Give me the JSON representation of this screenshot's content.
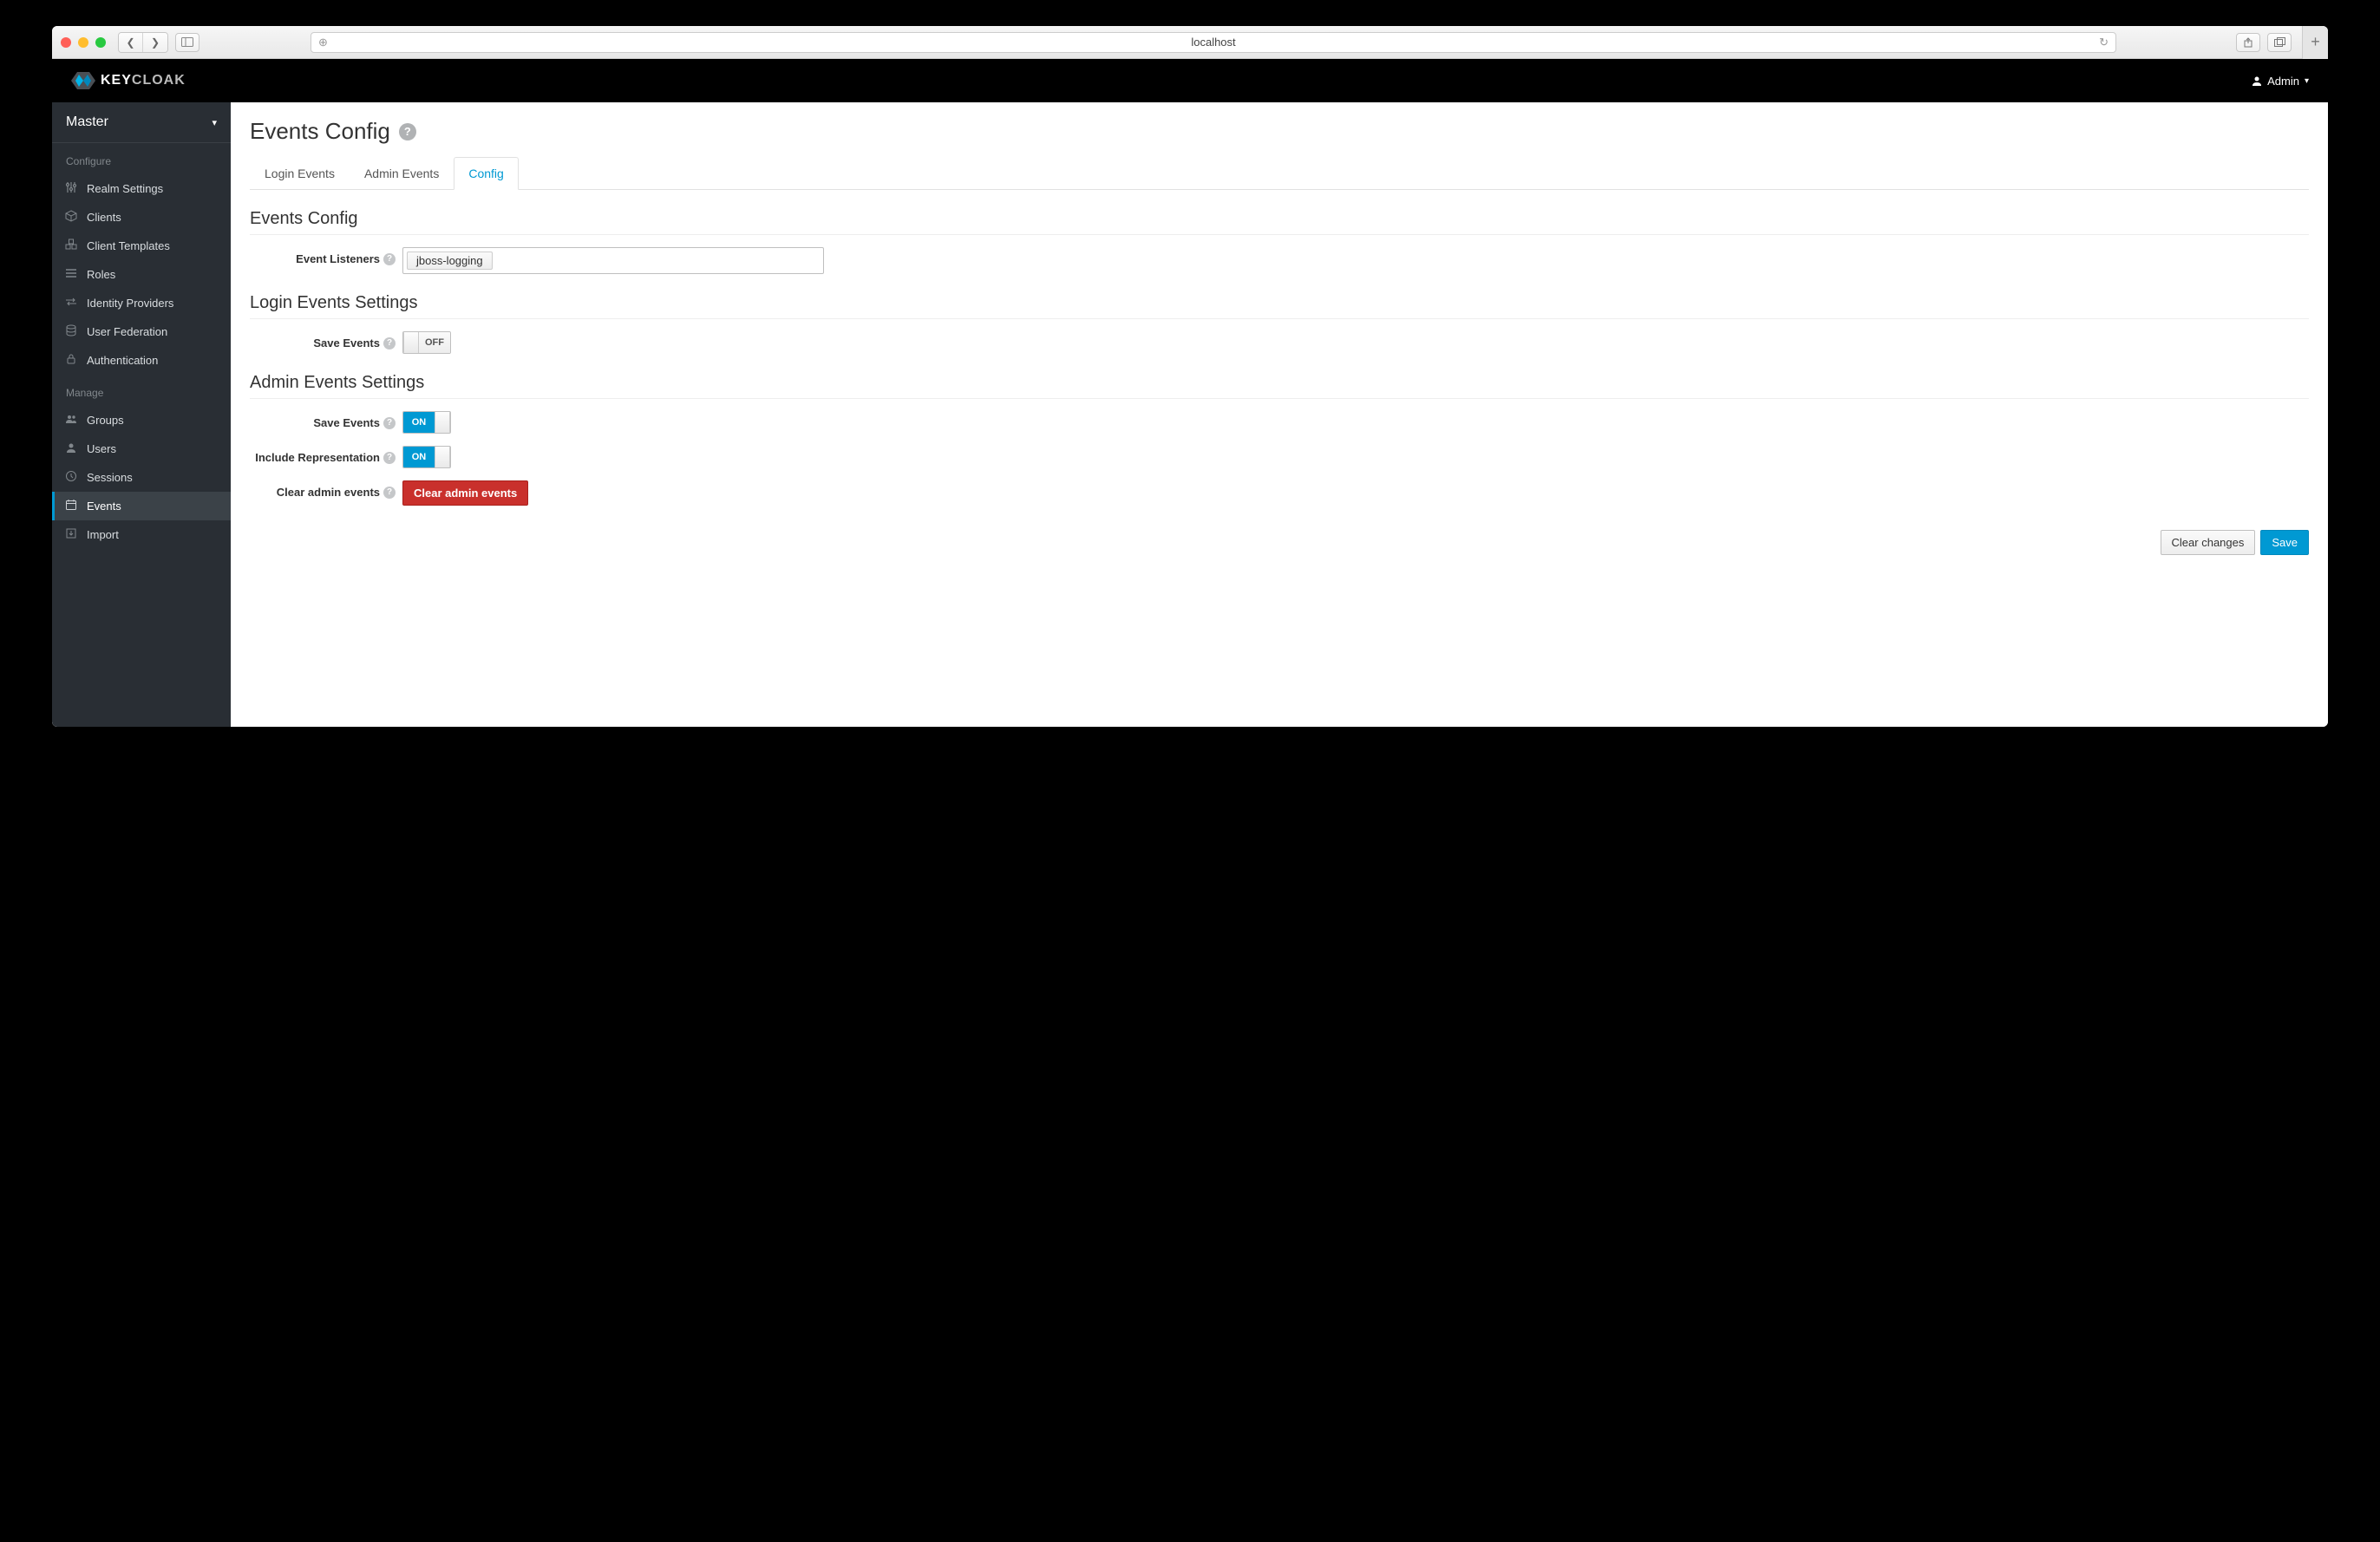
{
  "browser": {
    "host": "localhost"
  },
  "header": {
    "logo_prefix": "KEY",
    "logo_suffix": "CLOAK",
    "user_label": "Admin"
  },
  "sidebar": {
    "realm": "Master",
    "sections": {
      "configure_label": "Configure",
      "manage_label": "Manage"
    },
    "configure": [
      {
        "label": "Realm Settings"
      },
      {
        "label": "Clients"
      },
      {
        "label": "Client Templates"
      },
      {
        "label": "Roles"
      },
      {
        "label": "Identity Providers"
      },
      {
        "label": "User Federation"
      },
      {
        "label": "Authentication"
      }
    ],
    "manage": [
      {
        "label": "Groups"
      },
      {
        "label": "Users"
      },
      {
        "label": "Sessions"
      },
      {
        "label": "Events"
      },
      {
        "label": "Import"
      }
    ]
  },
  "page": {
    "title": "Events Config",
    "tabs": [
      {
        "label": "Login Events"
      },
      {
        "label": "Admin Events"
      },
      {
        "label": "Config"
      }
    ],
    "active_tab": 2,
    "section_events_config": "Events Config",
    "event_listeners_label": "Event Listeners",
    "event_listeners_chip": "jboss-logging",
    "section_login_settings": "Login Events Settings",
    "login_save_events_label": "Save Events",
    "login_save_events_value": "OFF",
    "section_admin_settings": "Admin Events Settings",
    "admin_save_events_label": "Save Events",
    "admin_save_events_value": "ON",
    "include_rep_label": "Include Representation",
    "include_rep_value": "ON",
    "clear_admin_label": "Clear admin events",
    "clear_admin_button": "Clear admin events",
    "clear_changes_button": "Clear changes",
    "save_button": "Save"
  }
}
